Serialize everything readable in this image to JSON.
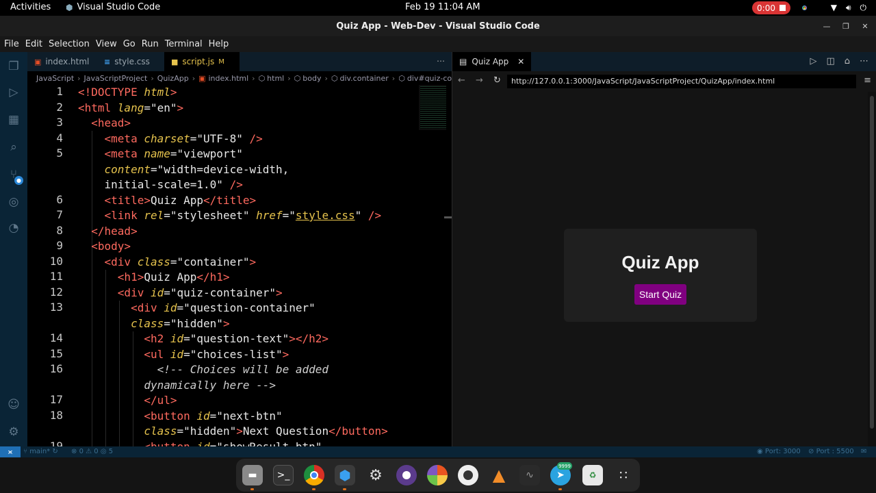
{
  "topbar": {
    "activities": "Activities",
    "app_name": "Visual Studio Code",
    "clock": "Feb 19  11:04 AM",
    "recording_time": "0:00"
  },
  "window": {
    "title": "Quiz App - Web-Dev - Visual Studio Code"
  },
  "menu": [
    "File",
    "Edit",
    "Selection",
    "View",
    "Go",
    "Run",
    "Terminal",
    "Help"
  ],
  "tabs": [
    {
      "label": "index.html",
      "icon": "html-file-icon",
      "active": false
    },
    {
      "label": "style.css",
      "icon": "css-file-icon",
      "active": false
    },
    {
      "label": "script.js",
      "icon": "js-file-icon",
      "active": true,
      "modified": "M"
    }
  ],
  "breadcrumb": [
    "JavaScript",
    "JavaScriptProject",
    "QuizApp",
    "index.html",
    "html",
    "body",
    "div.container",
    "div#quiz-containe"
  ],
  "line_numbers": [
    {
      "n": "1",
      "row": 0
    },
    {
      "n": "2",
      "row": 1
    },
    {
      "n": "3",
      "row": 2
    },
    {
      "n": "4",
      "row": 3
    },
    {
      "n": "5",
      "row": 4
    },
    {
      "n": "6",
      "row": 7
    },
    {
      "n": "7",
      "row": 8
    },
    {
      "n": "8",
      "row": 9
    },
    {
      "n": "9",
      "row": 10
    },
    {
      "n": "10",
      "row": 11
    },
    {
      "n": "11",
      "row": 12
    },
    {
      "n": "12",
      "row": 13
    },
    {
      "n": "13",
      "row": 14
    },
    {
      "n": "14",
      "row": 16
    },
    {
      "n": "15",
      "row": 17
    },
    {
      "n": "16",
      "row": 18
    },
    {
      "n": "17",
      "row": 20
    },
    {
      "n": "18",
      "row": 21
    },
    {
      "n": "19",
      "row": 23
    }
  ],
  "code_lines": [
    [
      [
        "t",
        "<!DOCTYPE "
      ],
      [
        "a",
        "html"
      ],
      [
        "t",
        ">"
      ]
    ],
    [
      [
        "t",
        "<html "
      ],
      [
        "a",
        "lang"
      ],
      [
        "p",
        "="
      ],
      [
        "v",
        "\"en\""
      ],
      [
        "t",
        ">"
      ]
    ],
    [
      [
        "p",
        "  "
      ],
      [
        "t",
        "<head>"
      ]
    ],
    [
      [
        "p",
        "    "
      ],
      [
        "t",
        "<meta "
      ],
      [
        "a",
        "charset"
      ],
      [
        "p",
        "="
      ],
      [
        "v",
        "\"UTF-8\""
      ],
      [
        "p",
        " "
      ],
      [
        "t",
        "/>"
      ]
    ],
    [
      [
        "p",
        "    "
      ],
      [
        "t",
        "<meta "
      ],
      [
        "a",
        "name"
      ],
      [
        "p",
        "="
      ],
      [
        "v",
        "\"viewport\""
      ]
    ],
    [
      [
        "p",
        "    "
      ],
      [
        "a",
        "content"
      ],
      [
        "p",
        "="
      ],
      [
        "v",
        "\"width=device-width,"
      ]
    ],
    [
      [
        "p",
        "    "
      ],
      [
        "v",
        "initial-scale=1.0\""
      ],
      [
        "p",
        " "
      ],
      [
        "t",
        "/>"
      ]
    ],
    [
      [
        "p",
        "    "
      ],
      [
        "t",
        "<title>"
      ],
      [
        "p",
        "Quiz App"
      ],
      [
        "t",
        "</title>"
      ]
    ],
    [
      [
        "p",
        "    "
      ],
      [
        "t",
        "<link "
      ],
      [
        "a",
        "rel"
      ],
      [
        "p",
        "="
      ],
      [
        "v",
        "\"stylesheet\""
      ],
      [
        "p",
        " "
      ],
      [
        "a",
        "href"
      ],
      [
        "p",
        "="
      ],
      [
        "v",
        "\""
      ],
      [
        "u",
        "style.css"
      ],
      [
        "v",
        "\""
      ],
      [
        "p",
        " "
      ],
      [
        "t",
        "/>"
      ]
    ],
    [
      [
        "p",
        "  "
      ],
      [
        "t",
        "</head>"
      ]
    ],
    [
      [
        "p",
        "  "
      ],
      [
        "t",
        "<body>"
      ]
    ],
    [
      [
        "p",
        "    "
      ],
      [
        "t",
        "<div "
      ],
      [
        "a",
        "class"
      ],
      [
        "p",
        "="
      ],
      [
        "v",
        "\"container\""
      ],
      [
        "t",
        ">"
      ]
    ],
    [
      [
        "p",
        "      "
      ],
      [
        "t",
        "<h1>"
      ],
      [
        "p",
        "Quiz App"
      ],
      [
        "t",
        "</h1>"
      ]
    ],
    [
      [
        "p",
        "      "
      ],
      [
        "t",
        "<div "
      ],
      [
        "a",
        "id"
      ],
      [
        "p",
        "="
      ],
      [
        "v",
        "\"quiz-container\""
      ],
      [
        "t",
        ">"
      ]
    ],
    [
      [
        "p",
        "        "
      ],
      [
        "t",
        "<div "
      ],
      [
        "a",
        "id"
      ],
      [
        "p",
        "="
      ],
      [
        "v",
        "\"question-container\""
      ]
    ],
    [
      [
        "p",
        "        "
      ],
      [
        "a",
        "class"
      ],
      [
        "p",
        "="
      ],
      [
        "v",
        "\"hidden\""
      ],
      [
        "t",
        ">"
      ]
    ],
    [
      [
        "p",
        "          "
      ],
      [
        "t",
        "<h2 "
      ],
      [
        "a",
        "id"
      ],
      [
        "p",
        "="
      ],
      [
        "v",
        "\"question-text\""
      ],
      [
        "t",
        "></h2>"
      ]
    ],
    [
      [
        "p",
        "          "
      ],
      [
        "t",
        "<ul "
      ],
      [
        "a",
        "id"
      ],
      [
        "p",
        "="
      ],
      [
        "v",
        "\"choices-list\""
      ],
      [
        "t",
        ">"
      ]
    ],
    [
      [
        "p",
        "            "
      ],
      [
        "c",
        "<!-- Choices will be added"
      ]
    ],
    [
      [
        "p",
        "          "
      ],
      [
        "c",
        "dynamically here -->"
      ]
    ],
    [
      [
        "p",
        "          "
      ],
      [
        "t",
        "</ul>"
      ]
    ],
    [
      [
        "p",
        "          "
      ],
      [
        "t",
        "<button "
      ],
      [
        "a",
        "id"
      ],
      [
        "p",
        "="
      ],
      [
        "v",
        "\"next-btn\""
      ]
    ],
    [
      [
        "p",
        "          "
      ],
      [
        "a",
        "class"
      ],
      [
        "p",
        "="
      ],
      [
        "v",
        "\"hidden\""
      ],
      [
        "t",
        ">"
      ],
      [
        "p",
        "Next Question"
      ],
      [
        "t",
        "</button>"
      ]
    ],
    [
      [
        "p",
        "          "
      ],
      [
        "t",
        "<button "
      ],
      [
        "a",
        "id"
      ],
      [
        "p",
        "="
      ],
      [
        "v",
        "\"showResult-btn\""
      ]
    ]
  ],
  "preview": {
    "tab_label": "Quiz App",
    "url": "http://127.0.0.1:3000/JavaScript/JavaScriptProject/QuizApp/index.html",
    "page_heading": "Quiz App",
    "start_button": "Start Quiz"
  },
  "statusbar": {
    "branch": "main*",
    "problems": "0",
    "warnings": "0",
    "ports": "5",
    "port_live": "Port: 3000",
    "port_server": "Port : 5500"
  },
  "dock": {
    "telegram_badge": "9999"
  },
  "colors": {
    "accent_purple": "#800080",
    "record_red": "#d93434",
    "activity_bar": "#0a2436"
  }
}
